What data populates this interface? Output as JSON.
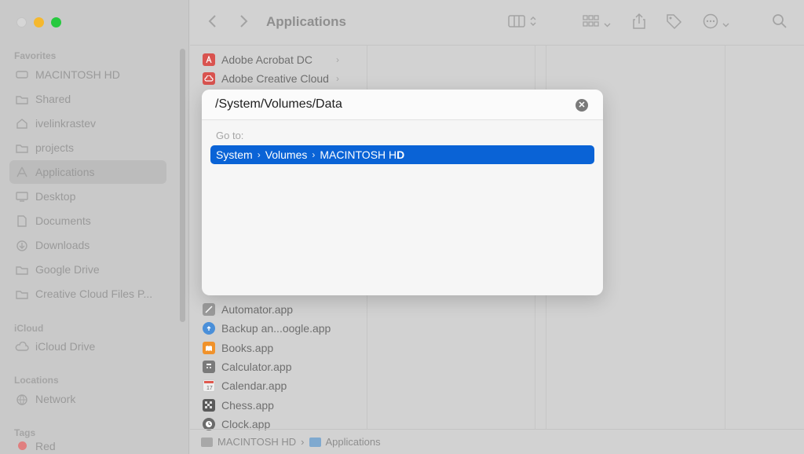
{
  "sidebar": {
    "favorites_label": "Favorites",
    "favorites": [
      {
        "label": "MACINTOSH HD",
        "icon": "disk-icon"
      },
      {
        "label": "Shared",
        "icon": "folder-icon"
      },
      {
        "label": "ivelinkrastev",
        "icon": "home-icon"
      },
      {
        "label": "projects",
        "icon": "folder-icon"
      },
      {
        "label": "Applications",
        "icon": "applications-icon",
        "selected": true
      },
      {
        "label": "Desktop",
        "icon": "desktop-icon"
      },
      {
        "label": "Documents",
        "icon": "document-icon"
      },
      {
        "label": "Downloads",
        "icon": "download-icon"
      },
      {
        "label": "Google Drive",
        "icon": "folder-icon"
      },
      {
        "label": "Creative Cloud Files P...",
        "icon": "folder-icon"
      }
    ],
    "icloud_label": "iCloud",
    "icloud": [
      {
        "label": "iCloud Drive",
        "icon": "cloud-icon"
      }
    ],
    "locations_label": "Locations",
    "locations": [
      {
        "label": "Network",
        "icon": "globe-icon"
      }
    ],
    "tags_label": "Tags",
    "tags": [
      {
        "label": "Red",
        "color": "#e07f7f"
      }
    ]
  },
  "toolbar": {
    "title": "Applications",
    "back_icon": "chevron-left-icon",
    "forward_icon": "chevron-right-icon"
  },
  "files": [
    {
      "label": "Adobe Acrobat DC",
      "icon_color": "#d9534f",
      "folder": true
    },
    {
      "label": "Adobe Creative Cloud",
      "icon_color": "#d9534f",
      "folder": true
    },
    {
      "label": "Automator.app",
      "icon_color": "#9a9a9a",
      "folder": false
    },
    {
      "label": "Backup an...oogle.app",
      "icon_color": "#4a8fd9",
      "folder": false
    },
    {
      "label": "Books.app",
      "icon_color": "#f0922b",
      "folder": false
    },
    {
      "label": "Calculator.app",
      "icon_color": "#7a7a7a",
      "folder": false
    },
    {
      "label": "Calendar.app",
      "icon_color": "#e8e8e8",
      "folder": false
    },
    {
      "label": "Chess.app",
      "icon_color": "#5a5a5a",
      "folder": false
    },
    {
      "label": "Clock.app",
      "icon_color": "#6a6a6a",
      "folder": false
    }
  ],
  "statusbar": {
    "disk": "MACINTOSH HD",
    "folder": "Applications"
  },
  "dialog": {
    "path_value": "/System/Volumes/Data",
    "goto_label": "Go to:",
    "suggestion": {
      "part1": "System",
      "part2": "Volumes",
      "part3_normal": "MACINTOSH H",
      "part3_bold": "D"
    }
  },
  "colors": {
    "accent": "#0a63d6",
    "traffic_min": "#f5b82e",
    "traffic_max": "#27c93f"
  }
}
